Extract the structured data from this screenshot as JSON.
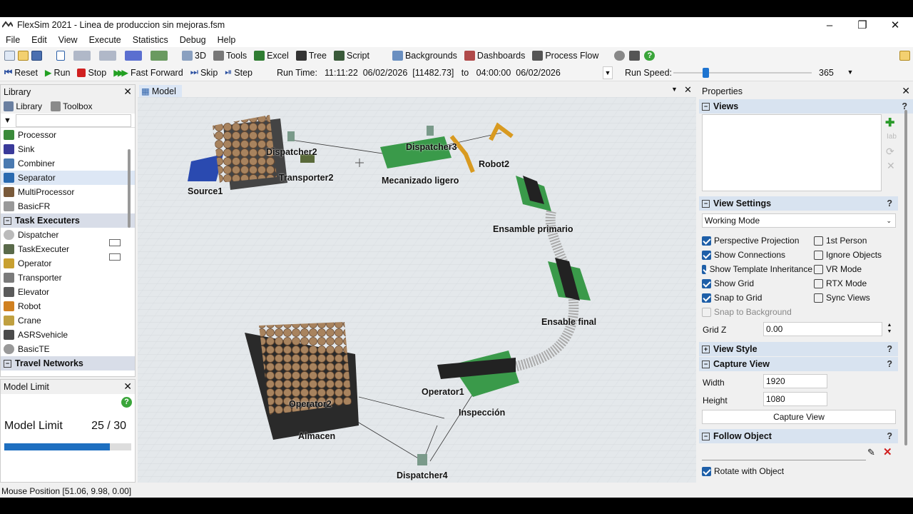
{
  "window": {
    "title": "FlexSim 2021 - Linea de produccion sin mejoras.fsm"
  },
  "menu": [
    "File",
    "Edit",
    "View",
    "Execute",
    "Statistics",
    "Debug",
    "Help"
  ],
  "toolbar": {
    "btn_3d": "3D",
    "tools": "Tools",
    "excel": "Excel",
    "tree": "Tree",
    "script": "Script",
    "backgrounds": "Backgrounds",
    "dashboards": "Dashboards",
    "process_flow": "Process Flow"
  },
  "runbar": {
    "reset": "Reset",
    "run": "Run",
    "stop": "Stop",
    "fast_forward": "Fast Forward",
    "skip": "Skip",
    "step": "Step",
    "run_time_label": "Run Time:",
    "run_time_value": "11:11:22  06/02/2026  [11482.73]   to   04:00:00  06/02/2026",
    "run_speed_label": "Run Speed:",
    "run_speed_value": "365"
  },
  "library": {
    "title": "Library",
    "tab_library": "Library",
    "tab_toolbox": "Toolbox",
    "fixed": [
      "Processor",
      "Sink",
      "Combiner",
      "Separator",
      "MultiProcessor",
      "BasicFR"
    ],
    "task_executers_label": "Task Executers",
    "executers": [
      "Dispatcher",
      "TaskExecuter",
      "Operator",
      "Transporter",
      "Elevator",
      "Robot",
      "Crane",
      "ASRSvehicle",
      "BasicTE"
    ],
    "travel_networks_label": "Travel Networks"
  },
  "model_limit": {
    "title": "Model Limit",
    "label": "Model Limit",
    "value": "25 / 30",
    "fraction": 0.83
  },
  "model_tab": {
    "label": "Model"
  },
  "scene_labels": {
    "source": "Source1",
    "dispatcher2": "Dispatcher2",
    "transporter2": "Transporter2",
    "dispatcher3": "Dispatcher3",
    "mecanizado": "Mecanizado ligero",
    "robot2": "Robot2",
    "ensamble_primario": "Ensamble primario",
    "ensable_final": "Ensable final",
    "operator1": "Operator1",
    "inspeccion": "Inspección",
    "operator2": "Operator2",
    "almacen": "Almacen",
    "dispatcher4": "Dispatcher4"
  },
  "properties": {
    "title": "Properties",
    "views": "Views",
    "view_settings": "View Settings",
    "mode": "Working Mode",
    "perspective": "Perspective Projection",
    "first_person": "1st Person",
    "show_connections": "Show Connections",
    "ignore_objects": "Ignore Objects",
    "show_template": "Show Template Inheritance",
    "vr_mode": "VR Mode",
    "show_grid": "Show Grid",
    "rtx_mode": "RTX Mode",
    "snap_grid": "Snap to Grid",
    "sync_views": "Sync Views",
    "snap_bg": "Snap to Background",
    "grid_z_label": "Grid Z",
    "grid_z_value": "0.00",
    "view_style": "View Style",
    "capture_view": "Capture View",
    "width_label": "Width",
    "width_value": "1920",
    "height_label": "Height",
    "height_value": "1080",
    "capture_button": "Capture View",
    "follow_object": "Follow Object",
    "rotate_with_object": "Rotate with Object"
  },
  "status": {
    "mouse_position": "Mouse Position [51.06, 9.98, 0.00]"
  }
}
